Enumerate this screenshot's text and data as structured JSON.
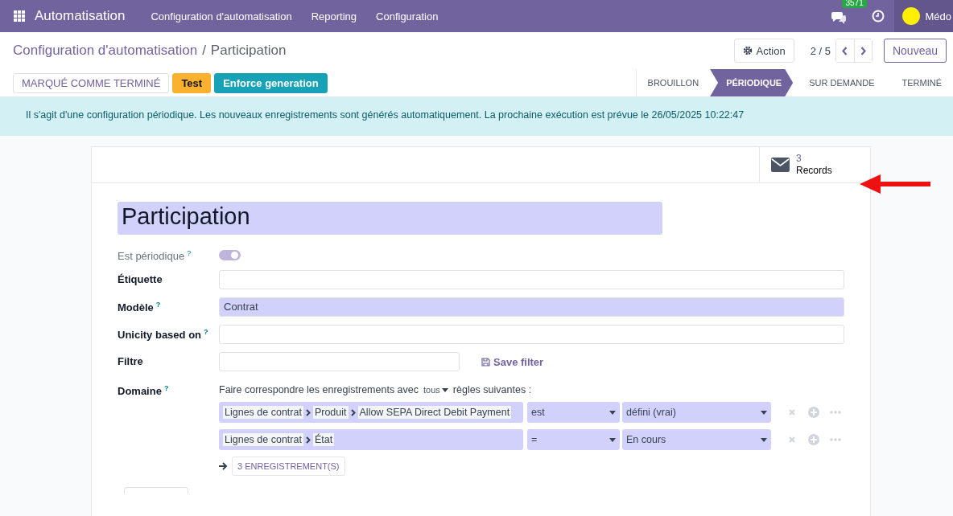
{
  "navbar": {
    "app_name": "Automatisation",
    "menu": [
      {
        "label": "Configuration d'automatisation"
      },
      {
        "label": "Reporting"
      },
      {
        "label": "Configuration"
      }
    ],
    "messages_badge": "3571",
    "user_name": "Médo"
  },
  "breadcrumb": {
    "parent": "Configuration d'automatisation",
    "separator": "/",
    "current": "Participation"
  },
  "actions": {
    "action_button": "Action",
    "pager": "2 / 5",
    "new_button": "Nouveau"
  },
  "header_buttons": [
    {
      "label": "MARQUÉ COMME TERMINÉ",
      "kind": "secondary"
    },
    {
      "label": "Test",
      "kind": "warning"
    },
    {
      "label": "Enforce generation",
      "kind": "info"
    }
  ],
  "statusbar": [
    {
      "label": "BROUILLON",
      "selected": false
    },
    {
      "label": "PÉRIODIQUE",
      "selected": true
    },
    {
      "label": "SUR DEMANDE",
      "selected": false
    },
    {
      "label": "TERMINÉ",
      "selected": false
    }
  ],
  "alert": "Il s'agit d'une configuration périodique. Les nouveaux enregistrements sont générés automatiquement. La prochaine exécution est prévue le 26/05/2025 10:22:47",
  "smart_button": {
    "count": "3",
    "label": "Records"
  },
  "title": "Participation",
  "fields": [
    {
      "label": "Est périodique",
      "help": "?",
      "kind": "toggle",
      "on": true,
      "readonly": true
    },
    {
      "label": "Étiquette",
      "kind": "text"
    },
    {
      "label": "Modèle",
      "help": "?",
      "kind": "text",
      "value": "Contrat",
      "required": true
    },
    {
      "label": "Unicity based on",
      "help": "?",
      "kind": "text"
    },
    {
      "label": "Filtre",
      "kind": "filter",
      "link": "Save filter"
    }
  ],
  "domain": {
    "label": "Domaine",
    "help": "?",
    "intro_before": "Faire correspondre les enregistrements avec",
    "match": "tous",
    "intro_after": "règles suivantes :",
    "rules": [
      {
        "path": [
          "Lignes de contrat",
          "Produit",
          "Allow SEPA Direct Debit Payment"
        ],
        "operator": "est",
        "value": "défini (vrai)"
      },
      {
        "path": [
          "Lignes de contrat",
          "État"
        ],
        "operator": "=",
        "value": "En cours"
      }
    ],
    "records_button": "3 ENREGISTREMENT(S)"
  }
}
